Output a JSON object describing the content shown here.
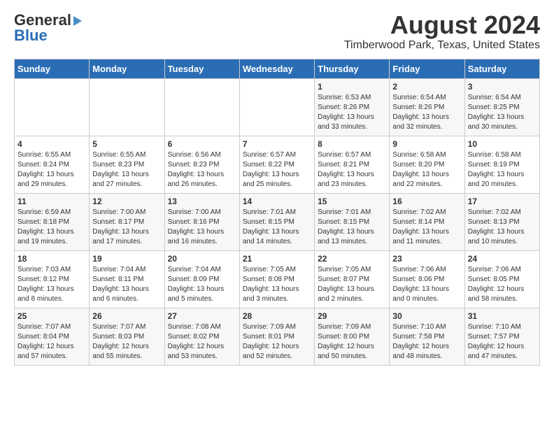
{
  "header": {
    "logo_general": "General",
    "logo_blue": "Blue",
    "title": "August 2024",
    "subtitle": "Timberwood Park, Texas, United States"
  },
  "calendar": {
    "days_of_week": [
      "Sunday",
      "Monday",
      "Tuesday",
      "Wednesday",
      "Thursday",
      "Friday",
      "Saturday"
    ],
    "weeks": [
      [
        {
          "day": "",
          "info": ""
        },
        {
          "day": "",
          "info": ""
        },
        {
          "day": "",
          "info": ""
        },
        {
          "day": "",
          "info": ""
        },
        {
          "day": "1",
          "info": "Sunrise: 6:53 AM\nSunset: 8:26 PM\nDaylight: 13 hours\nand 33 minutes."
        },
        {
          "day": "2",
          "info": "Sunrise: 6:54 AM\nSunset: 8:26 PM\nDaylight: 13 hours\nand 32 minutes."
        },
        {
          "day": "3",
          "info": "Sunrise: 6:54 AM\nSunset: 8:25 PM\nDaylight: 13 hours\nand 30 minutes."
        }
      ],
      [
        {
          "day": "4",
          "info": "Sunrise: 6:55 AM\nSunset: 8:24 PM\nDaylight: 13 hours\nand 29 minutes."
        },
        {
          "day": "5",
          "info": "Sunrise: 6:55 AM\nSunset: 8:23 PM\nDaylight: 13 hours\nand 27 minutes."
        },
        {
          "day": "6",
          "info": "Sunrise: 6:56 AM\nSunset: 8:23 PM\nDaylight: 13 hours\nand 26 minutes."
        },
        {
          "day": "7",
          "info": "Sunrise: 6:57 AM\nSunset: 8:22 PM\nDaylight: 13 hours\nand 25 minutes."
        },
        {
          "day": "8",
          "info": "Sunrise: 6:57 AM\nSunset: 8:21 PM\nDaylight: 13 hours\nand 23 minutes."
        },
        {
          "day": "9",
          "info": "Sunrise: 6:58 AM\nSunset: 8:20 PM\nDaylight: 13 hours\nand 22 minutes."
        },
        {
          "day": "10",
          "info": "Sunrise: 6:58 AM\nSunset: 8:19 PM\nDaylight: 13 hours\nand 20 minutes."
        }
      ],
      [
        {
          "day": "11",
          "info": "Sunrise: 6:59 AM\nSunset: 8:18 PM\nDaylight: 13 hours\nand 19 minutes."
        },
        {
          "day": "12",
          "info": "Sunrise: 7:00 AM\nSunset: 8:17 PM\nDaylight: 13 hours\nand 17 minutes."
        },
        {
          "day": "13",
          "info": "Sunrise: 7:00 AM\nSunset: 8:16 PM\nDaylight: 13 hours\nand 16 minutes."
        },
        {
          "day": "14",
          "info": "Sunrise: 7:01 AM\nSunset: 8:15 PM\nDaylight: 13 hours\nand 14 minutes."
        },
        {
          "day": "15",
          "info": "Sunrise: 7:01 AM\nSunset: 8:15 PM\nDaylight: 13 hours\nand 13 minutes."
        },
        {
          "day": "16",
          "info": "Sunrise: 7:02 AM\nSunset: 8:14 PM\nDaylight: 13 hours\nand 11 minutes."
        },
        {
          "day": "17",
          "info": "Sunrise: 7:02 AM\nSunset: 8:13 PM\nDaylight: 13 hours\nand 10 minutes."
        }
      ],
      [
        {
          "day": "18",
          "info": "Sunrise: 7:03 AM\nSunset: 8:12 PM\nDaylight: 13 hours\nand 8 minutes."
        },
        {
          "day": "19",
          "info": "Sunrise: 7:04 AM\nSunset: 8:11 PM\nDaylight: 13 hours\nand 6 minutes."
        },
        {
          "day": "20",
          "info": "Sunrise: 7:04 AM\nSunset: 8:09 PM\nDaylight: 13 hours\nand 5 minutes."
        },
        {
          "day": "21",
          "info": "Sunrise: 7:05 AM\nSunset: 8:08 PM\nDaylight: 13 hours\nand 3 minutes."
        },
        {
          "day": "22",
          "info": "Sunrise: 7:05 AM\nSunset: 8:07 PM\nDaylight: 13 hours\nand 2 minutes."
        },
        {
          "day": "23",
          "info": "Sunrise: 7:06 AM\nSunset: 8:06 PM\nDaylight: 13 hours\nand 0 minutes."
        },
        {
          "day": "24",
          "info": "Sunrise: 7:06 AM\nSunset: 8:05 PM\nDaylight: 12 hours\nand 58 minutes."
        }
      ],
      [
        {
          "day": "25",
          "info": "Sunrise: 7:07 AM\nSunset: 8:04 PM\nDaylight: 12 hours\nand 57 minutes."
        },
        {
          "day": "26",
          "info": "Sunrise: 7:07 AM\nSunset: 8:03 PM\nDaylight: 12 hours\nand 55 minutes."
        },
        {
          "day": "27",
          "info": "Sunrise: 7:08 AM\nSunset: 8:02 PM\nDaylight: 12 hours\nand 53 minutes."
        },
        {
          "day": "28",
          "info": "Sunrise: 7:09 AM\nSunset: 8:01 PM\nDaylight: 12 hours\nand 52 minutes."
        },
        {
          "day": "29",
          "info": "Sunrise: 7:09 AM\nSunset: 8:00 PM\nDaylight: 12 hours\nand 50 minutes."
        },
        {
          "day": "30",
          "info": "Sunrise: 7:10 AM\nSunset: 7:58 PM\nDaylight: 12 hours\nand 48 minutes."
        },
        {
          "day": "31",
          "info": "Sunrise: 7:10 AM\nSunset: 7:57 PM\nDaylight: 12 hours\nand 47 minutes."
        }
      ]
    ]
  }
}
